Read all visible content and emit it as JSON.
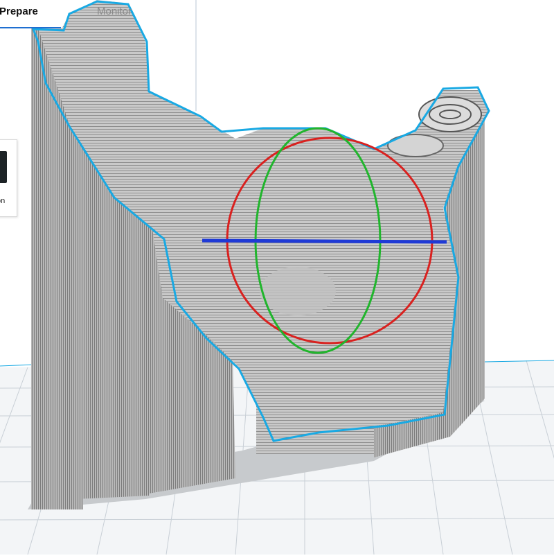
{
  "app": {
    "stages": [
      {
        "label": "Prepare",
        "active": true
      },
      {
        "label": "Monitor",
        "active": false
      }
    ]
  },
  "side_panel": {
    "label": "on",
    "icon": "dark-square-icon"
  },
  "viewport": {
    "content": "3d-model-with-rotate-gizmo",
    "colors": {
      "background": "#ffffff",
      "build_plate_grid": "#c8cfd6",
      "model": "#b5b5b5",
      "outline": "#19a9e3",
      "gizmo_x": "#d9211f",
      "gizmo_y": "#21b52d",
      "gizmo_z": "#1f3ad6",
      "accent": "#1f6fd1"
    }
  }
}
